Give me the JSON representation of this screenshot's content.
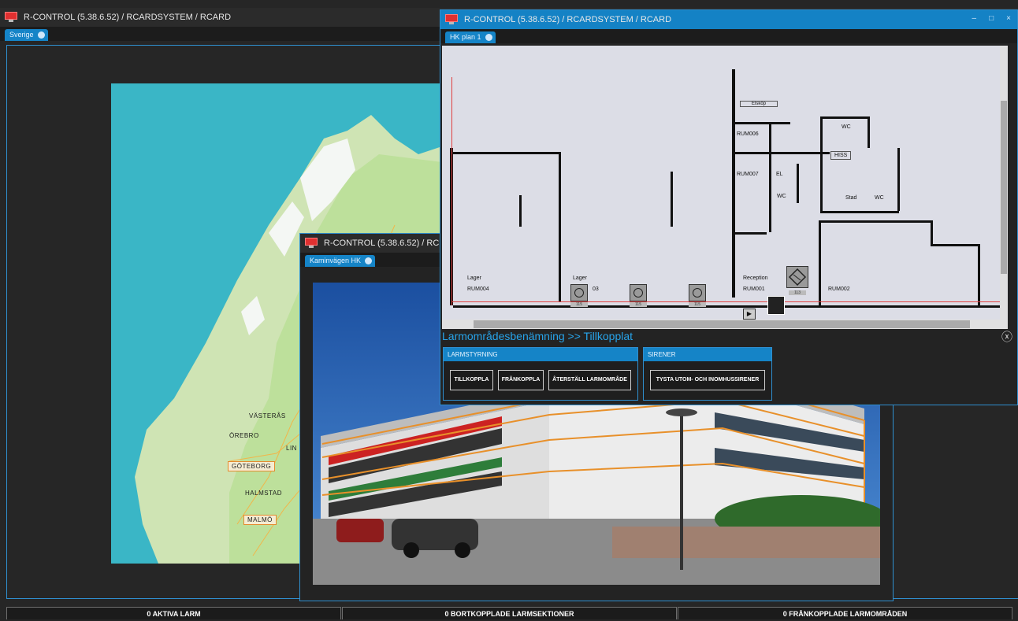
{
  "main_window": {
    "title": "R-CONTROL (5.38.6.52)  / RCARDSYSTEM / RCARD",
    "tab": "Sverige",
    "map": {
      "cities": [
        "VÄSTERÅS",
        "ÖREBRO",
        "LIN",
        "GÖTEBORG",
        "HALMSTAD",
        "MALMÖ"
      ]
    }
  },
  "photo_window": {
    "title": "R-CONTROL (5.38.6.52)  / RC",
    "tab": "Kaminvägen HK"
  },
  "plan_window": {
    "title": "R-CONTROL (5.38.6.52)  / RCARDSYSTEM / RCARD",
    "tab": "HK plan 1",
    "controls": {
      "minimize": "–",
      "maximize": "□",
      "close": "×"
    },
    "rooms": [
      "Elsköp",
      "RUM006",
      "WC",
      "HISS",
      "RUM007",
      "EL",
      "WC",
      "Stad",
      "WC",
      "Lager",
      "RUM004",
      "Lager",
      "03",
      "Reception",
      "RUM001",
      "RUM002"
    ],
    "sensor_numbers": [
      "115",
      "115",
      "115",
      "113"
    ],
    "breadcrumb": "Larmområdesbenämning >> Tillkopplat",
    "close_glyph": "ⓧ",
    "larmstyrning": {
      "heading": "LARMSTYRNING",
      "buttons": [
        "TILLKOPPLA",
        "FRÅNKOPPLA",
        "ÅTERSTÄLL LARMOMRÅDE"
      ]
    },
    "sirener": {
      "heading": "SIRENER",
      "buttons": [
        "TYSTA UTOM- OCH INOMHUSSIRENER"
      ]
    }
  },
  "status_bar": [
    "0 AKTIVA LARM",
    "0 BORTKOPPLADE LARMSEKTIONER",
    "0 FRÅNKOPPLADE LARMOMRÅDEN"
  ],
  "colors": {
    "accent": "#1584c7",
    "background": "#262626",
    "alarm_line": "#e8902a"
  },
  "icons": [
    "app-monitor-icon",
    "tab-close-icon",
    "alarm-sensor-icon",
    "siren-icon",
    "door-icon",
    "scroll-arrow-icon"
  ]
}
